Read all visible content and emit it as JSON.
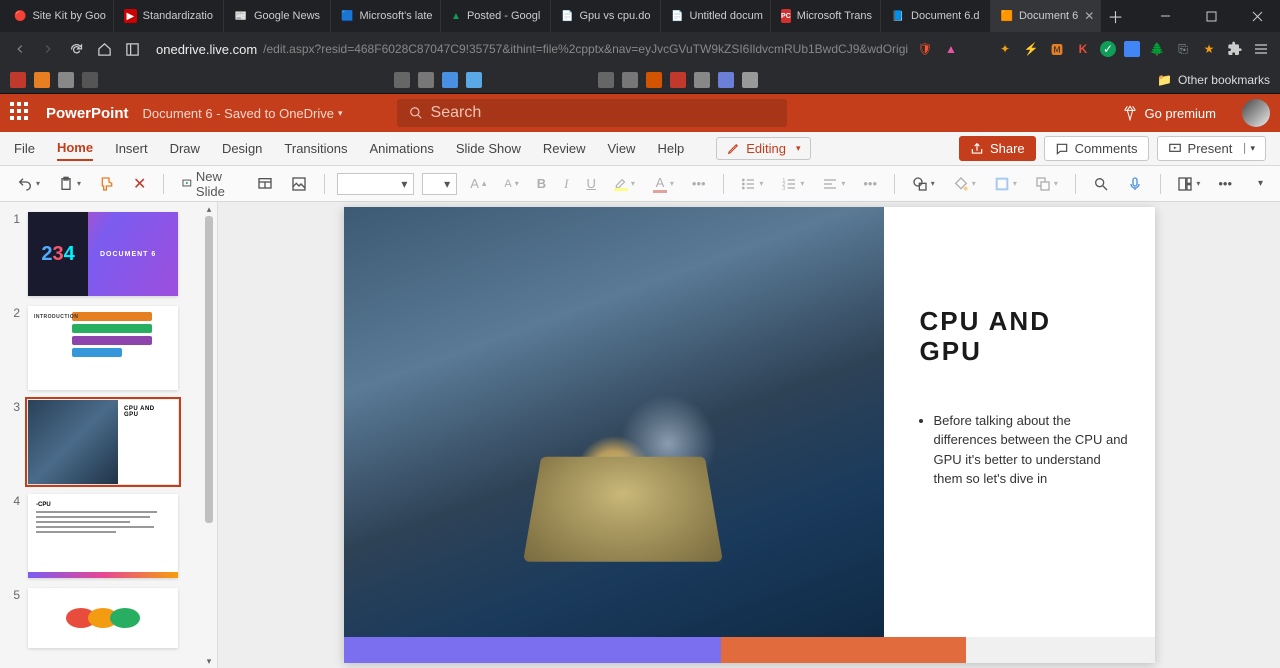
{
  "browser": {
    "tabs": [
      {
        "icon": "🔴",
        "label": "Site Kit by Goo"
      },
      {
        "icon": "▶",
        "label": "Standardizatio"
      },
      {
        "icon": "📰",
        "label": "Google News"
      },
      {
        "icon": "🟦",
        "label": "Microsoft's late"
      },
      {
        "icon": "▲",
        "label": "Posted - Googl"
      },
      {
        "icon": "📄",
        "label": "Gpu vs cpu.do"
      },
      {
        "icon": "📄",
        "label": "Untitled docum"
      },
      {
        "icon": "PC",
        "label": "Microsoft Trans"
      },
      {
        "icon": "📘",
        "label": "Document 6.d"
      },
      {
        "icon": "🟧",
        "label": "Document 6"
      }
    ],
    "active_tab": 9,
    "url_host": "onedrive.live.com",
    "url_path": "/edit.aspx?resid=468F6028C87047C9!35757&ithint=file%2cpptx&nav=eyJvcGVuTW9kZSI6IldvcmRUb1BwdCJ9&wdOrigin=Word",
    "other_bookmarks": "Other bookmarks",
    "bookmark_colors": [
      "#c0392b",
      "#3498db",
      "#27ae60",
      "#f1c40f",
      "#9b59b6",
      "#e67e22",
      "#1abc9c",
      "#ffffff",
      "#555555",
      "#6b7fd7",
      "#4a90e2",
      "#5aa9e6",
      "#888888",
      "#999999",
      "#aa5500",
      "#7f8c8d",
      "#c0c0c0",
      "#e74c3c",
      "#3498db"
    ]
  },
  "pp": {
    "app": "PowerPoint",
    "doc": "Document 6 - Saved to OneDrive",
    "search_placeholder": "Search",
    "go_premium": "Go premium"
  },
  "ribbon": {
    "tabs": [
      "File",
      "Home",
      "Insert",
      "Draw",
      "Design",
      "Transitions",
      "Animations",
      "Slide Show",
      "Review",
      "View",
      "Help"
    ],
    "active": 1,
    "editing": "Editing",
    "share": "Share",
    "comments": "Comments",
    "present": "Present"
  },
  "toolbar": {
    "new_slide": "New Slide"
  },
  "thumbs": [
    "1",
    "2",
    "3",
    "4",
    "5"
  ],
  "selected_thumb": 2,
  "slide": {
    "title_l1": "CPU AND",
    "title_l2": "GPU",
    "bullet": "Before talking about the differences between the CPU and GPU it's better to understand them so let's dive in"
  },
  "thumb1": {
    "title": "DOCUMENT 6"
  },
  "thumb2": {
    "label": "INTRODUCTION"
  },
  "thumb3": {
    "h1": "CPU AND",
    "h2": "GPU"
  },
  "thumb4": {
    "h": "-CPU"
  }
}
